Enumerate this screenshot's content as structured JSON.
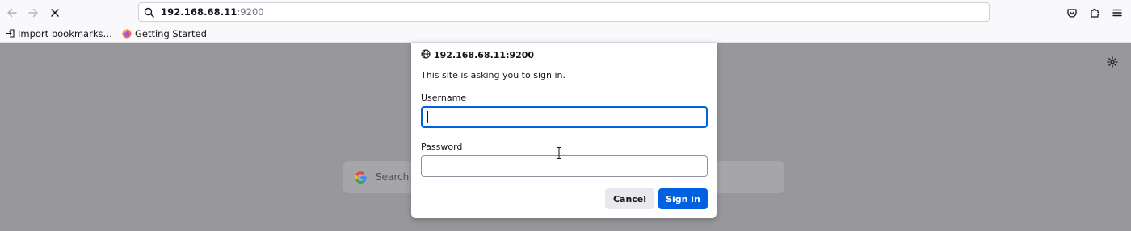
{
  "toolbar": {
    "url_host": "192.168.68.11",
    "url_port": ":9200",
    "icons": {
      "back": "back-arrow-icon",
      "forward": "forward-arrow-icon",
      "stop": "stop-loading-icon",
      "search": "search-icon",
      "pocket": "pocket-icon",
      "extensions": "extensions-icon",
      "menu": "hamburger-menu-icon"
    }
  },
  "bookmarks": {
    "items": [
      {
        "label": "Import bookmarks…",
        "icon": "import-icon"
      },
      {
        "label": "Getting Started",
        "icon": "firefox-icon"
      }
    ]
  },
  "page": {
    "search_placeholder": "Search w",
    "icons": {
      "settings": "gear-icon",
      "google": "google-logo-icon"
    }
  },
  "dialog": {
    "origin": "192.168.68.11:9200",
    "message": "This site is asking you to sign in.",
    "username_label": "Username",
    "username_value": "",
    "password_label": "Password",
    "password_value": "",
    "cancel_label": "Cancel",
    "signin_label": "Sign in"
  },
  "colors": {
    "accent": "#0061e0",
    "overlay": "#98979c",
    "dialog_bg": "#ffffff"
  }
}
